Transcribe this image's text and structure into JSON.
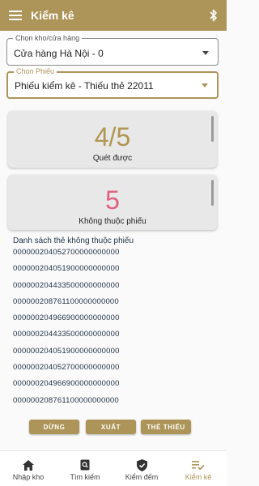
{
  "app_bar": {
    "title": "Kiểm kê"
  },
  "store_select": {
    "label": "Chọn kho/cửa hàng",
    "value": "Cửa hàng Hà Nội - 0"
  },
  "ticket_select": {
    "label": "Chọn Phiếu",
    "value": "Phiếu kiểm kê - Thiếu thẻ 22011"
  },
  "scanned_card": {
    "value": "4/5",
    "caption": "Quét được"
  },
  "outside_card": {
    "value": "5",
    "caption": "Không thuộc phiếu"
  },
  "tag_list": {
    "title": "Danh sách thẻ không thuộc phiếu",
    "items": [
      "000000204052700000000000",
      "000000204051900000000000",
      "000000204433500000000000",
      "000000208761100000000000",
      "000000204966900000000000",
      "000000204433500000000000",
      "000000204051900000000000",
      "000000204052700000000000",
      "000000204966900000000000",
      "000000208761100000000000"
    ]
  },
  "actions": {
    "stop": "DỪNG",
    "export": "XUẤT",
    "missing": "THẺ THIẾU"
  },
  "bottom_nav": [
    {
      "label": "Nhập kho",
      "icon": "home-icon"
    },
    {
      "label": "Tìm kiếm",
      "icon": "search-doc-icon"
    },
    {
      "label": "Kiểm đếm",
      "icon": "shield-check-icon"
    },
    {
      "label": "Kiểm kê",
      "icon": "checklist-icon"
    }
  ],
  "colors": {
    "primary": "#ad9458",
    "accent_pink": "#e0607e",
    "text_dark": "#1e2f45"
  },
  "active_nav": "Kiểm kê"
}
